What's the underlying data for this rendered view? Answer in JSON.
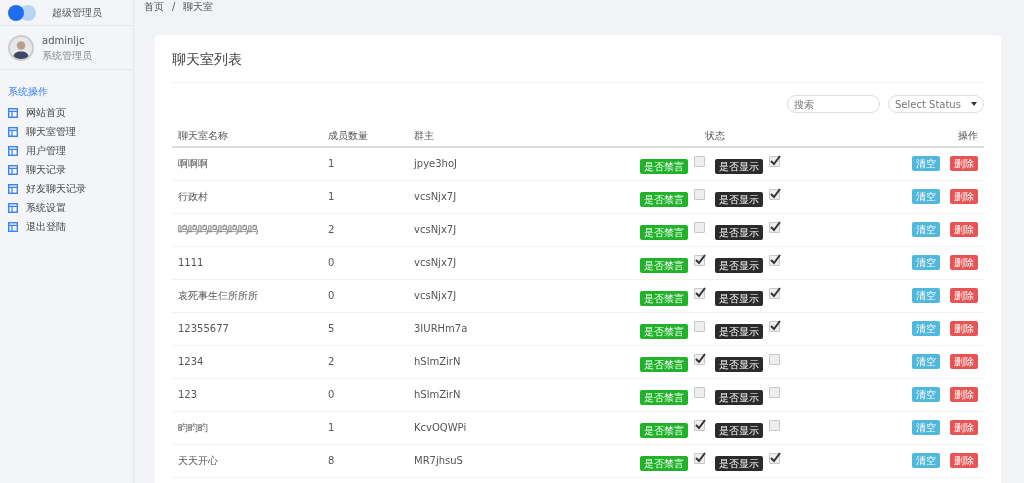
{
  "sidebar": {
    "brand": "超级管理员",
    "user": {
      "name": "adminljc",
      "role": "系统管理员"
    },
    "section": "系统操作",
    "items": [
      {
        "label": "网站首页"
      },
      {
        "label": "聊天室管理"
      },
      {
        "label": "用户管理"
      },
      {
        "label": "聊天记录"
      },
      {
        "label": "好友聊天记录"
      },
      {
        "label": "系统设置"
      },
      {
        "label": "退出登陆"
      }
    ]
  },
  "breadcrumb": [
    "首页",
    "/",
    "聊天室"
  ],
  "card": {
    "title": "聊天室列表",
    "search": {
      "placeholder": "搜索"
    },
    "status_select": "Select Status"
  },
  "table": {
    "columns": [
      "聊天室名称",
      "成员数量",
      "群主",
      "状态",
      "操作"
    ],
    "rows": [
      {
        "name": "啊啊啊",
        "members": "1",
        "owner": "jpye3hoJ",
        "mute_label": "是否禁言",
        "muted": false,
        "show_label": "是否显示",
        "shown": true,
        "actions": [
          "清空",
          "删除"
        ]
      },
      {
        "name": "行政村",
        "members": "1",
        "owner": "vcsNjx7J",
        "mute_label": "是否禁言",
        "muted": false,
        "show_label": "是否显示",
        "shown": true,
        "actions": [
          "清空",
          "删除"
        ]
      },
      {
        "name": "呜呜呜呜呜呜呜呜",
        "members": "2",
        "owner": "vcsNjx7J",
        "mute_label": "是否禁言",
        "muted": false,
        "show_label": "是否显示",
        "shown": true,
        "actions": [
          "清空",
          "删除"
        ]
      },
      {
        "name": "1111",
        "members": "0",
        "owner": "vcsNjx7J",
        "mute_label": "是否禁言",
        "muted": true,
        "show_label": "是否显示",
        "shown": true,
        "actions": [
          "清空",
          "删除"
        ]
      },
      {
        "name": "哀死事生仨所所所",
        "members": "0",
        "owner": "vcsNjx7J",
        "mute_label": "是否禁言",
        "muted": true,
        "show_label": "是否显示",
        "shown": true,
        "actions": [
          "清空",
          "删除"
        ]
      },
      {
        "name": "12355677",
        "members": "5",
        "owner": "3IURHm7a",
        "mute_label": "是否禁言",
        "muted": false,
        "show_label": "是否显示",
        "shown": true,
        "actions": [
          "清空",
          "删除"
        ]
      },
      {
        "name": "1234",
        "members": "2",
        "owner": "hSlmZirN",
        "mute_label": "是否禁言",
        "muted": true,
        "show_label": "是否显示",
        "shown": false,
        "actions": [
          "清空",
          "删除"
        ]
      },
      {
        "name": "123",
        "members": "0",
        "owner": "hSlmZirN",
        "mute_label": "是否禁言",
        "muted": false,
        "show_label": "是否显示",
        "shown": false,
        "actions": [
          "清空",
          "删除"
        ]
      },
      {
        "name": "畇畇畇",
        "members": "1",
        "owner": "KcvOQWPi",
        "mute_label": "是否禁言",
        "muted": true,
        "show_label": "是否显示",
        "shown": false,
        "actions": [
          "清空",
          "删除"
        ]
      },
      {
        "name": "天天开心",
        "members": "8",
        "owner": "MR7jhsuS",
        "mute_label": "是否禁言",
        "muted": true,
        "show_label": "是否显示",
        "shown": true,
        "actions": [
          "清空",
          "删除"
        ]
      }
    ]
  }
}
